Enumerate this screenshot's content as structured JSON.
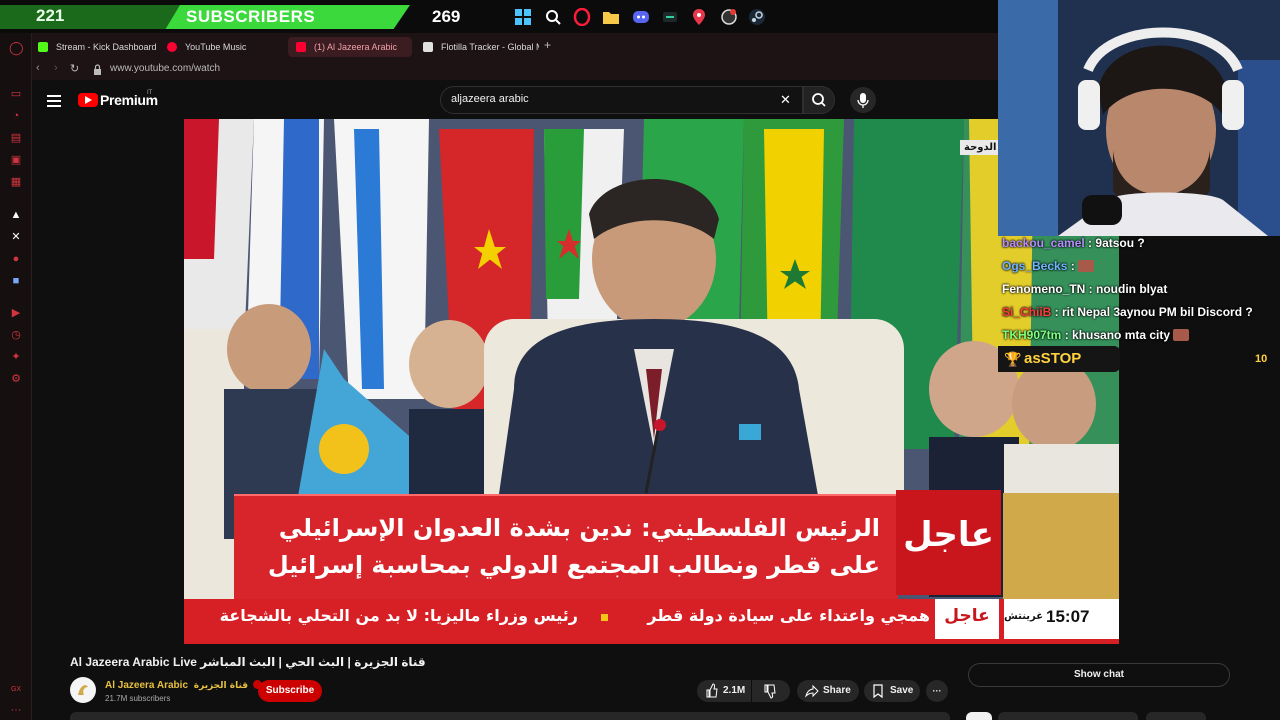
{
  "overlay": {
    "subscriber_count": "221",
    "subscriber_label": "SUBSCRIBERS",
    "subscriber_goal": "269"
  },
  "browser": {
    "tabs": [
      {
        "label": "Stream - Kick Dashboard",
        "color": "#53fc18"
      },
      {
        "label": "YouTube Music",
        "color": "#ff0033"
      },
      {
        "label": "(1) Al Jazeera Arabic",
        "color": "#ff0033"
      },
      {
        "label": "Flotilla Tracker - Global M",
        "color": "#ffffff"
      }
    ],
    "new_tab": "+",
    "url": "www.youtube.com/watch"
  },
  "youtube": {
    "logo_text": "Premium",
    "region": "IT",
    "search_value": "aljazeera arabic",
    "video_title": "Al Jazeera Arabic Live قناة الجزيرة | البث الحي | البث المباشر",
    "channel_name": "Al Jazeera Arabic",
    "channel_name_ar": "قناة الجزيرة",
    "channel_subs": "21.7M subscribers",
    "subscribe": "Subscribe",
    "likes": "2.1M",
    "share": "Share",
    "save": "Save",
    "more": "···",
    "show_chat": "Show chat"
  },
  "broadcast": {
    "location_tag": "الدوحة",
    "urgent": "عاجل",
    "headline_line1": "الرئيس الفلسطيني: ندين بشدة العدوان الإسرائيلي",
    "headline_line2": "على قطر ونطالب المجتمع الدولي بمحاسبة إسرائيل",
    "ticker_urgent": "عاجل",
    "ticker_text": "رئيس وزراء ماليزيا: لا بد من التحلي بالشجاعة",
    "ticker_text_prev": "همجي واعتداء على سيادة دولة قطر",
    "time": "15:07",
    "time_zone": "غرينتش"
  },
  "chat": {
    "messages": [
      {
        "user": "backou_camel",
        "text": "9atsou ?",
        "color": "#b48cff"
      },
      {
        "user": "Ogs_Becks",
        "text": "",
        "color": "#6fb4ff"
      },
      {
        "user": "Fenomeno_TN",
        "text": "noudin blyat",
        "color": "#ffffff"
      },
      {
        "user": "Si_ChiiB",
        "text": "rit Nepal 3aynou PM bil Discord ?",
        "color": "#ff3b3b"
      },
      {
        "user": "TKH907tm",
        "text": "khusano mta city",
        "color": "#7dff7d"
      }
    ],
    "goal_name": "asSTOP",
    "goal_value": "10"
  }
}
